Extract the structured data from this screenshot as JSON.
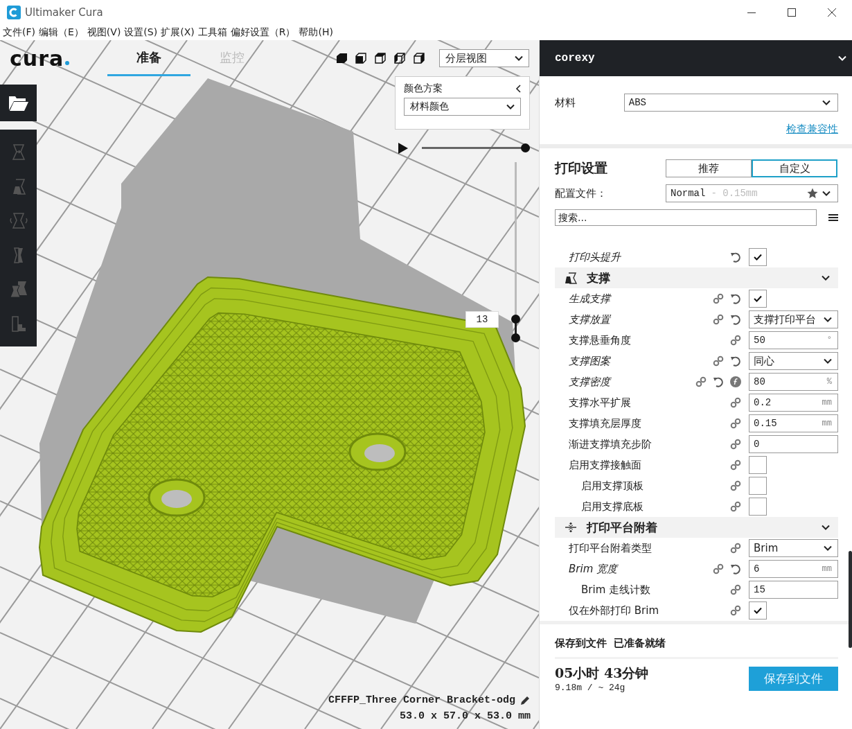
{
  "window": {
    "title": "Ultimaker Cura"
  },
  "menu": [
    "文件(F)",
    "编辑（E）",
    "视图(V)",
    "设置(S)",
    "扩展(X)",
    "工具箱",
    "偏好设置（R）",
    "帮助(H)"
  ],
  "logo": "cura",
  "stage_tabs": [
    {
      "label": "准备",
      "selected": true
    },
    {
      "label": "监控",
      "selected": false
    }
  ],
  "view_select": {
    "value": "分层视图"
  },
  "color_scheme": {
    "title": "颜色方案",
    "value": "材料颜色"
  },
  "layer_slider": {
    "level": 1
  },
  "layer_range": {
    "value": "13",
    "level": 0.11
  },
  "object": {
    "name": "CFFFP_Three Corner Bracket-odg",
    "dimensions": "53.0 x 57.0 x 53.0 mm"
  },
  "printer": {
    "name": "corexy"
  },
  "material": {
    "label": "材料",
    "value": "ABS",
    "link": "检查兼容性"
  },
  "print_settings": {
    "title": "打印设置",
    "modes": [
      {
        "label": "推荐",
        "selected": false
      },
      {
        "label": "自定义",
        "selected": true
      }
    ],
    "profile_label": "配置文件：",
    "profile": "Normal",
    "profile_detail": "- 0.15mm",
    "search_placeholder": "搜索..."
  },
  "settings": [
    {
      "kind": "checkbox",
      "label": "打印头提升",
      "modified": true,
      "linked": false,
      "resettable": true,
      "has_function": false,
      "checked": true
    },
    {
      "kind": "category",
      "label": "支撑",
      "expanded": true
    },
    {
      "kind": "checkbox",
      "label": "生成支撑",
      "modified": true,
      "linked": true,
      "resettable": true,
      "has_function": false,
      "checked": true
    },
    {
      "kind": "select",
      "label": "支撑放置",
      "modified": true,
      "linked": true,
      "resettable": true,
      "has_function": false,
      "value": "支撑打印平台"
    },
    {
      "kind": "number",
      "label": "支撑悬垂角度",
      "modified": false,
      "linked": true,
      "resettable": false,
      "has_function": false,
      "value": "50",
      "unit": "°"
    },
    {
      "kind": "select",
      "label": "支撑图案",
      "modified": true,
      "linked": true,
      "resettable": true,
      "has_function": false,
      "value": "同心"
    },
    {
      "kind": "number",
      "label": "支撑密度",
      "modified": true,
      "linked": true,
      "resettable": true,
      "has_function": true,
      "value": "80",
      "unit": "%"
    },
    {
      "kind": "number",
      "label": "支撑水平扩展",
      "modified": false,
      "linked": true,
      "resettable": false,
      "has_function": false,
      "value": "0.2",
      "unit": "mm"
    },
    {
      "kind": "number",
      "label": "支撑填充层厚度",
      "modified": false,
      "linked": true,
      "resettable": false,
      "has_function": false,
      "value": "0.15",
      "unit": "mm"
    },
    {
      "kind": "number",
      "label": "渐进支撑填充步阶",
      "modified": false,
      "linked": true,
      "resettable": false,
      "has_function": false,
      "value": "0"
    },
    {
      "kind": "checkbox",
      "label": "启用支撑接触面",
      "modified": false,
      "linked": true,
      "resettable": false,
      "has_function": false,
      "checked": false,
      "children": [
        {
          "kind": "checkbox",
          "label": "启用支撑顶板",
          "modified": false,
          "linked": true,
          "resettable": false,
          "has_function": false,
          "checked": false
        },
        {
          "kind": "checkbox",
          "label": "启用支撑底板",
          "modified": false,
          "linked": true,
          "resettable": false,
          "has_function": false,
          "checked": false
        }
      ]
    },
    {
      "kind": "category",
      "label": "打印平台附着",
      "expanded": true
    },
    {
      "kind": "select",
      "label": "打印平台附着类型",
      "modified": false,
      "linked": true,
      "resettable": false,
      "has_function": false,
      "value": "Brim"
    },
    {
      "kind": "number",
      "label": "Brim 宽度",
      "modified": true,
      "linked": true,
      "resettable": true,
      "has_function": false,
      "value": "6",
      "unit": "mm",
      "children": [
        {
          "kind": "number",
          "label": "Brim 走线计数",
          "modified": false,
          "linked": true,
          "resettable": false,
          "has_function": false,
          "value": "15"
        }
      ]
    },
    {
      "kind": "checkbox",
      "label": "仅在外部打印 Brim",
      "modified": false,
      "linked": true,
      "resettable": false,
      "has_function": false,
      "checked": true
    }
  ],
  "footer": {
    "status_title": "保存到文件",
    "status": "已准备就绪",
    "time": "05小时 43分钟",
    "material_usage": "9.18m / ~ 24g",
    "button": "保存到文件"
  }
}
